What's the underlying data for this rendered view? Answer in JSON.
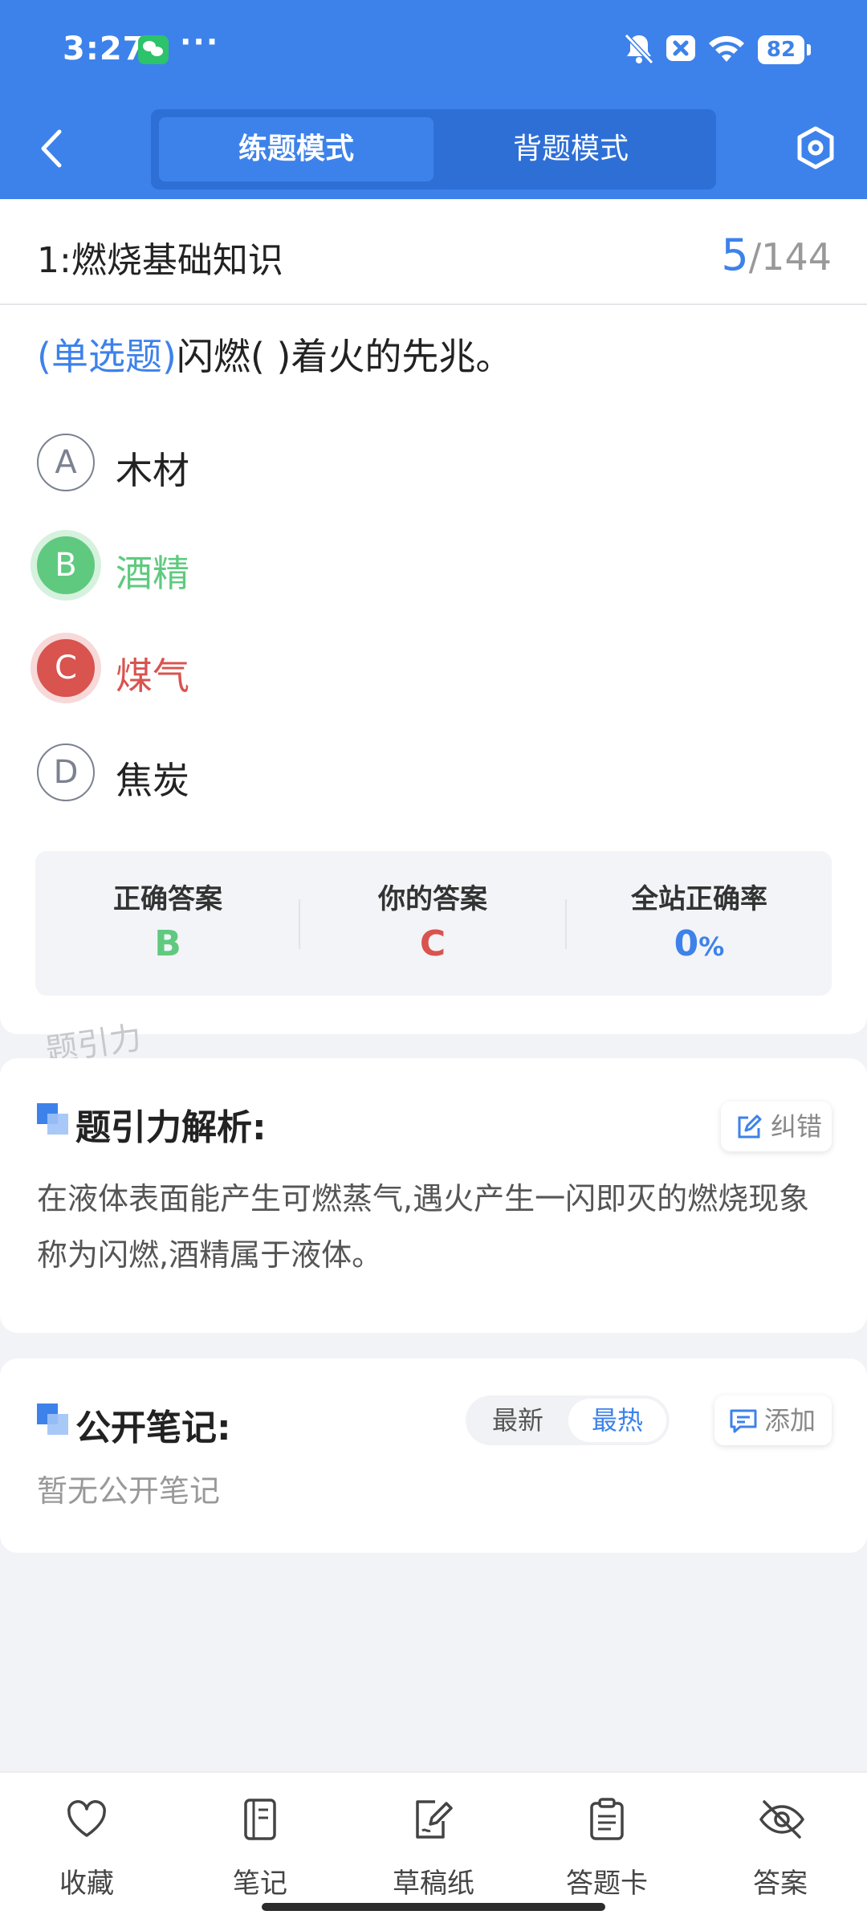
{
  "status_bar": {
    "time": "3:27",
    "more": "···",
    "battery": "82"
  },
  "header": {
    "tabs": [
      {
        "label": "练题模式",
        "active": true
      },
      {
        "label": "背题模式",
        "active": false
      }
    ]
  },
  "section": {
    "title": "1:燃烧基础知识",
    "current": "5",
    "total": "/144"
  },
  "question": {
    "type": "(单选题)",
    "text": "闪燃(        )着火的先兆。",
    "options": [
      {
        "letter": "A",
        "text": "木材",
        "state": "normal"
      },
      {
        "letter": "B",
        "text": "酒精",
        "state": "correct"
      },
      {
        "letter": "C",
        "text": "煤气",
        "state": "wrong"
      },
      {
        "letter": "D",
        "text": "焦炭",
        "state": "normal"
      }
    ]
  },
  "answer_summary": {
    "correct_label": "正确答案",
    "correct_value": "B",
    "yours_label": "你的答案",
    "yours_value": "C",
    "rate_label": "全站正确率",
    "rate_value": "0",
    "rate_unit": "%"
  },
  "watermark": "题引力",
  "analysis": {
    "title": "题引力解析:",
    "correct_button": "纠错",
    "text": "在液体表面能产生可燃蒸气,遇火产生一闪即灭的燃烧现象称为闪燃,酒精属于液体。"
  },
  "notes": {
    "title": "公开笔记:",
    "sort_newest": "最新",
    "sort_hot": "最热",
    "add_button": "添加",
    "empty": "暂无公开笔记"
  },
  "bottom_bar": {
    "favorite": "收藏",
    "note": "笔记",
    "draft": "草稿纸",
    "answer_card": "答题卡",
    "answer": "答案"
  },
  "colors": {
    "primary": "#3d82ea",
    "correct": "#5fca7f",
    "wrong": "#d9534f"
  }
}
